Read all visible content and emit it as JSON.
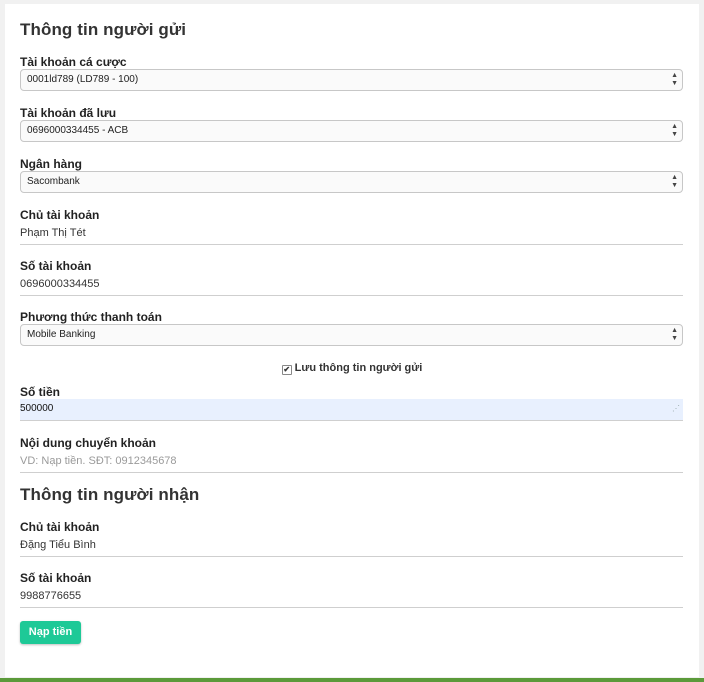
{
  "sender": {
    "title": "Thông tin người gửi",
    "betting_account": {
      "label": "Tài khoản cá cược",
      "value": "0001ld789 (LD789 - 100)"
    },
    "saved_account": {
      "label": "Tài khoản đã lưu",
      "value": "0696000334455 - ACB"
    },
    "bank": {
      "label": "Ngân hàng",
      "value": "Sacombank"
    },
    "account_holder": {
      "label": "Chủ tài khoản",
      "value": "Phạm Thị Tét"
    },
    "account_number": {
      "label": "Số tài khoản",
      "value": "0696000334455"
    },
    "payment_method": {
      "label": "Phương thức thanh toán",
      "value": "Mobile Banking"
    },
    "save_info": {
      "label": "Lưu thông tin người gửi",
      "checked": true,
      "check_glyph": "✔"
    },
    "amount": {
      "label": "Số tiền",
      "value": "500000"
    },
    "transfer_note": {
      "label": "Nội dung chuyển khoản",
      "placeholder": "VD: Nạp tiền. SĐT: 0912345678"
    }
  },
  "receiver": {
    "title": "Thông tin người nhận",
    "account_holder": {
      "label": "Chủ tài khoản",
      "value": "Đặng Tiểu Bình"
    },
    "account_number": {
      "label": "Số tài khoản",
      "value": "9988776655"
    }
  },
  "actions": {
    "submit_label": "Nạp tiền"
  },
  "icons": {
    "select_arrows": "updown-arrows-icon"
  },
  "colors": {
    "accent": "#1ec997",
    "autofill": "#e8f0fe",
    "bottom_bar": "#5b9a3a"
  }
}
